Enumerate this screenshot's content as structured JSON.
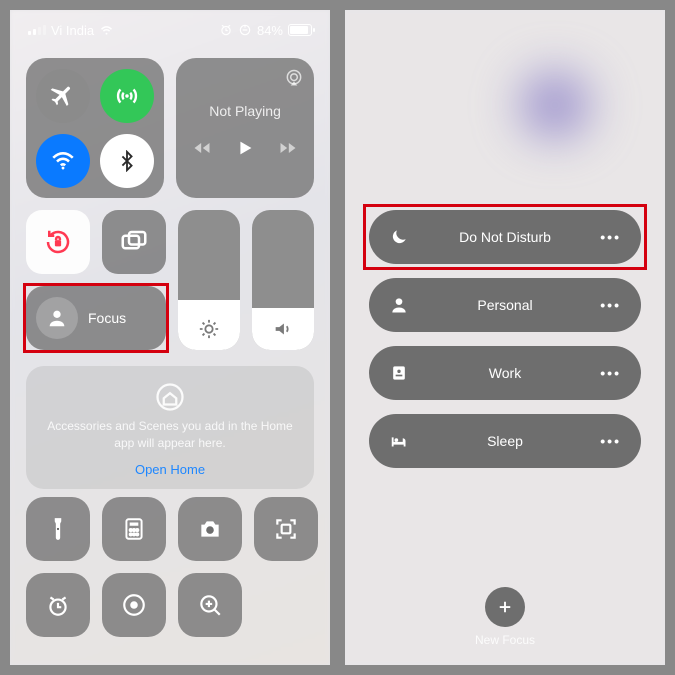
{
  "status": {
    "carrier": "Vi India",
    "battery_pct": "84%"
  },
  "media": {
    "title": "Not Playing"
  },
  "focus_tile": {
    "label": "Focus"
  },
  "home": {
    "text": "Accessories and Scenes you add in the Home app will appear here.",
    "link": "Open Home"
  },
  "focus_modes": {
    "dnd": "Do Not Disturb",
    "personal": "Personal",
    "work": "Work",
    "sleep": "Sleep",
    "new": "New Focus"
  }
}
